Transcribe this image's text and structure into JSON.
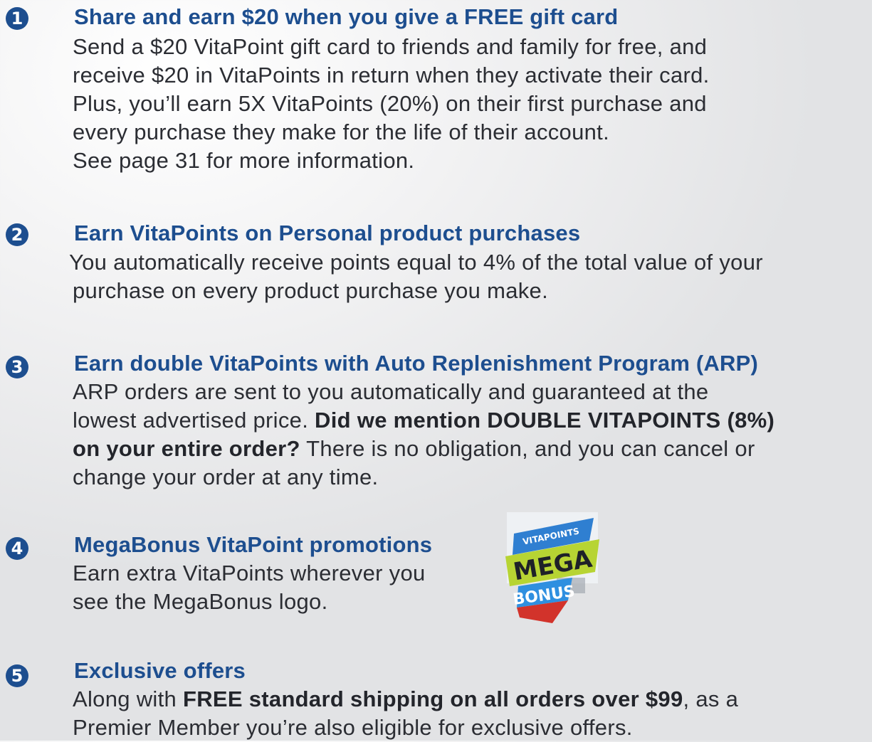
{
  "items": [
    {
      "number": "1",
      "title": "Share and earn $20 when you give a FREE gift card",
      "lines": [
        "Send a $20 VitaPoint gift card to friends and family for free, and",
        "receive $20 in VitaPoints in return when they activate their card.",
        "Plus, you’ll earn 5X VitaPoints (20%) on their first purchase and",
        "every purchase they make for the life of their account.",
        "See page 31 for more information."
      ]
    },
    {
      "number": "2",
      "title": "Earn VitaPoints on Personal product purchases",
      "lines": [
        "You automatically receive points equal to 4% of the total value of your",
        "purchase on every product purchase you make."
      ]
    },
    {
      "number": "3",
      "title": "Earn double VitaPoints with Auto Replenishment Program (ARP)",
      "line1": "ARP orders are sent to you automatically and guaranteed at the",
      "line2_plain": "lowest advertised price. ",
      "line2_bold": "Did we mention DOUBLE VITAPOINTS (8%)",
      "line3_bold": "on your entire order?",
      "line3_plain": " There is no obligation, and you can cancel or",
      "line4": "change your order at any time."
    },
    {
      "number": "4",
      "title": "MegaBonus VitaPoint promotions",
      "lines": [
        "Earn extra VitaPoints wherever you",
        "see the MegaBonus logo."
      ]
    },
    {
      "number": "5",
      "title": "Exclusive offers",
      "line1_plain_a": "Along with ",
      "line1_bold": "FREE standard shipping on all orders over $99",
      "line1_plain_b": ", as a",
      "line2": "Premier Member you’re also eligible for exclusive offers."
    }
  ],
  "logo": {
    "top_text": "VITAPOINTS",
    "middle_text": "MEGA",
    "bottom_text": "BONUS"
  },
  "colors": {
    "accent": "#1d4e8f",
    "text": "#2b2d33",
    "logo_blue": "#2f7fd1",
    "logo_green": "#b7d433",
    "logo_red": "#d2332b"
  }
}
